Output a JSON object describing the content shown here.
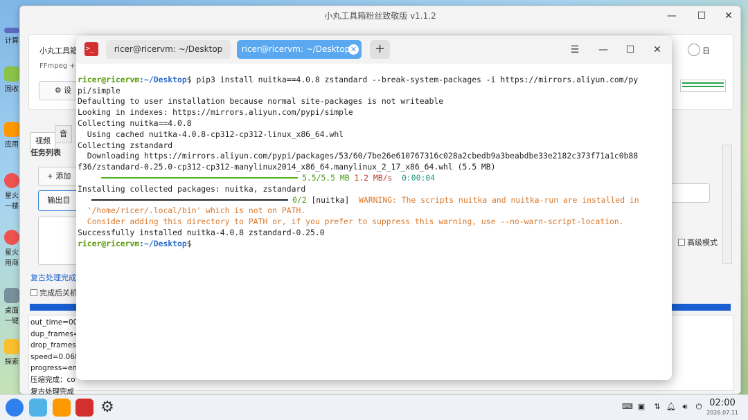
{
  "desktop": {
    "icons": [
      "计算",
      "回收",
      "应用",
      "星火一楼",
      "星火用商",
      "桌面一键",
      "探索"
    ]
  },
  "app": {
    "title": "小丸工具箱粉丝致敬版 v1.1.2",
    "header_label": "小丸工具箱",
    "ffmpeg_label": "FFmpeg +",
    "radio_label": "日",
    "tabs": [
      "视频",
      "音"
    ],
    "task_list_label": "任务列表",
    "add_button": "+ 添加",
    "output_button": "输出目",
    "settings_button": "⚙ 设",
    "advanced_mode_label": "高级模式",
    "restore_done_label": "复古处理完成",
    "shutdown_label": "完成后关机",
    "log_lines": [
      "out_time=00:",
      "dup_frames=",
      "drop_frames",
      "speed=0.0688",
      "progress=end",
      "压缩完成：co",
      "复古处理完成"
    ]
  },
  "terminal": {
    "tabs": [
      {
        "label": "ricer@ricervm: ~/Desktop"
      },
      {
        "label": "ricer@ricervm: ~/Desktop"
      }
    ],
    "prompt_user": "ricer@ricervm",
    "prompt_path": ":~/Desktop",
    "command": "$ pip3 install nuitka==4.0.8 zstandard --break-system-packages -i https://mirrors.aliyun.com/py",
    "command_wrap": "pi/simple",
    "lines": [
      "Defaulting to user installation because normal site-packages is not writeable",
      "Looking in indexes: https://mirrors.aliyun.com/pypi/simple",
      "Collecting nuitka==4.0.8",
      "  Using cached nuitka-4.0.8-cp312-cp312-linux_x86_64.whl",
      "Collecting zstandard",
      "  Downloading https://mirrors.aliyun.com/pypi/packages/53/60/7be26e610767316c028a2cbedb9a3beabdbe33e2182c373f71a1c0b88",
      "f36/zstandard-0.25.0-cp312-cp312-manylinux2014_x86_64.manylinux_2_17_x86_64.whl (5.5 MB)"
    ],
    "download_progress": {
      "size": "5.5/5.5 MB",
      "speed": "1.2 MB/s",
      "eta": "0:00:04",
      "fraction": 1.0
    },
    "installing_line": "Installing collected packages: nuitka, zstandard",
    "install_progress": {
      "count": "0/2",
      "pkg": "[nuitka]",
      "fraction": 0.0
    },
    "warning_1": "  WARNING: The scripts nuitka and nuitka-run are installed in",
    "warning_2": "  '/home/ricer/.local/bin' which is not on PATH.",
    "warning_3": "  Consider adding this directory to PATH or, if you prefer to suppress this warning, use --no-warn-script-location.",
    "success_line": "Successfully installed nuitka-4.0.8 zstandard-0.25.0",
    "final_prompt_dollar": "$"
  },
  "taskbar": {
    "time": "02:00",
    "date": "2026.07.11"
  },
  "colors": {
    "terminal_tab_active": "#5aa8ef",
    "prompt_user": "#5b9a0b",
    "prompt_path": "#2a6bc9",
    "warning": "#d9772a",
    "app_progress": "#1a5fd1"
  }
}
